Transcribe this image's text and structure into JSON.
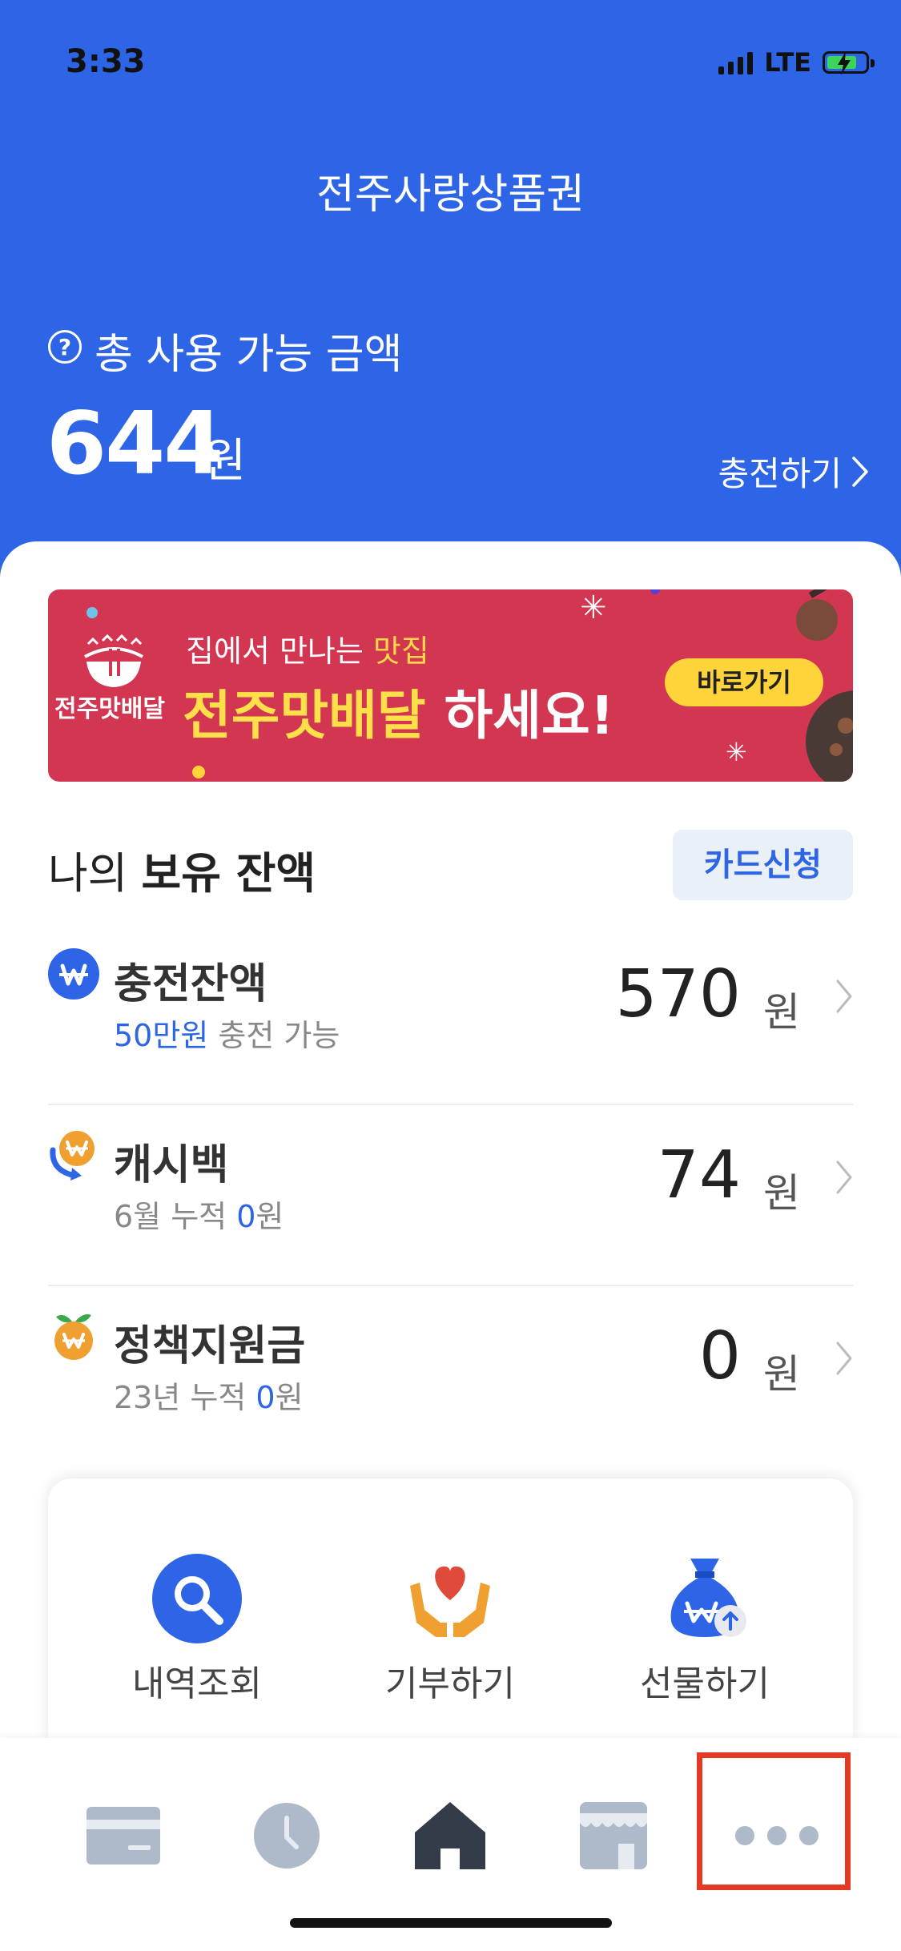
{
  "status": {
    "time": "3:33",
    "network": "LTE"
  },
  "header": {
    "title": "전주사랑상품권",
    "total_label": "총 사용 가능 금액",
    "total_amount": "644",
    "currency_unit": "원",
    "charge_link": "충전하기"
  },
  "banner": {
    "logo_text": "전주맛배달",
    "subtitle_prefix": "집에서 만나는 ",
    "subtitle_highlight": "맛집",
    "headline_highlight": "전주맛배달",
    "headline_suffix": " 하세요!",
    "button_label": "바로가기"
  },
  "balance_section": {
    "title_normal": "나의 ",
    "title_bold": "보유 잔액",
    "card_apply_label": "카드신청",
    "items": [
      {
        "name": "충전잔액",
        "sub_highlight": "50만원",
        "sub_suffix": " 충전 가능",
        "amount": "570",
        "unit": "원"
      },
      {
        "name": "캐시백",
        "sub_prefix": "6월 누적 ",
        "sub_value": "0",
        "sub_suffix": "원",
        "amount": "74",
        "unit": "원"
      },
      {
        "name": "정책지원금",
        "sub_prefix": "23년 누적 ",
        "sub_value": "0",
        "sub_suffix": "원",
        "amount": "0",
        "unit": "원"
      }
    ]
  },
  "quick_actions": [
    {
      "label": "내역조회",
      "icon": "search-icon"
    },
    {
      "label": "기부하기",
      "icon": "donate-heart-hands-icon"
    },
    {
      "label": "선물하기",
      "icon": "gift-money-bag-icon"
    }
  ],
  "tab_bar": [
    {
      "name": "card",
      "icon": "card-icon",
      "active": false
    },
    {
      "name": "history",
      "icon": "clock-icon",
      "active": false
    },
    {
      "name": "home",
      "icon": "home-icon",
      "active": true
    },
    {
      "name": "store",
      "icon": "store-icon",
      "active": false
    },
    {
      "name": "more",
      "icon": "more-dots-icon",
      "active": false
    }
  ],
  "colors": {
    "primary": "#2e64e6",
    "banner": "#d23651",
    "highlight_box": "#e23a24",
    "accent_yellow": "#ffd43b"
  }
}
